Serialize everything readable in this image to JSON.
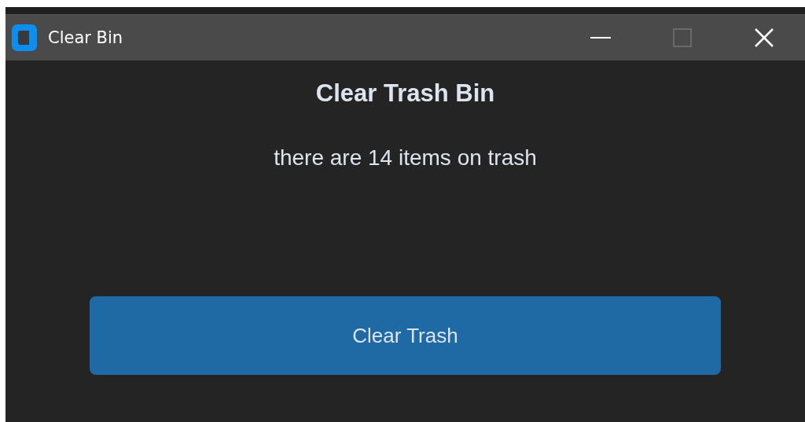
{
  "window": {
    "title": "Clear Bin",
    "maximize_disabled": true
  },
  "heading": "Clear Trash Bin",
  "message": "there are 14 items on trash",
  "button": {
    "label": "Clear Trash"
  }
}
